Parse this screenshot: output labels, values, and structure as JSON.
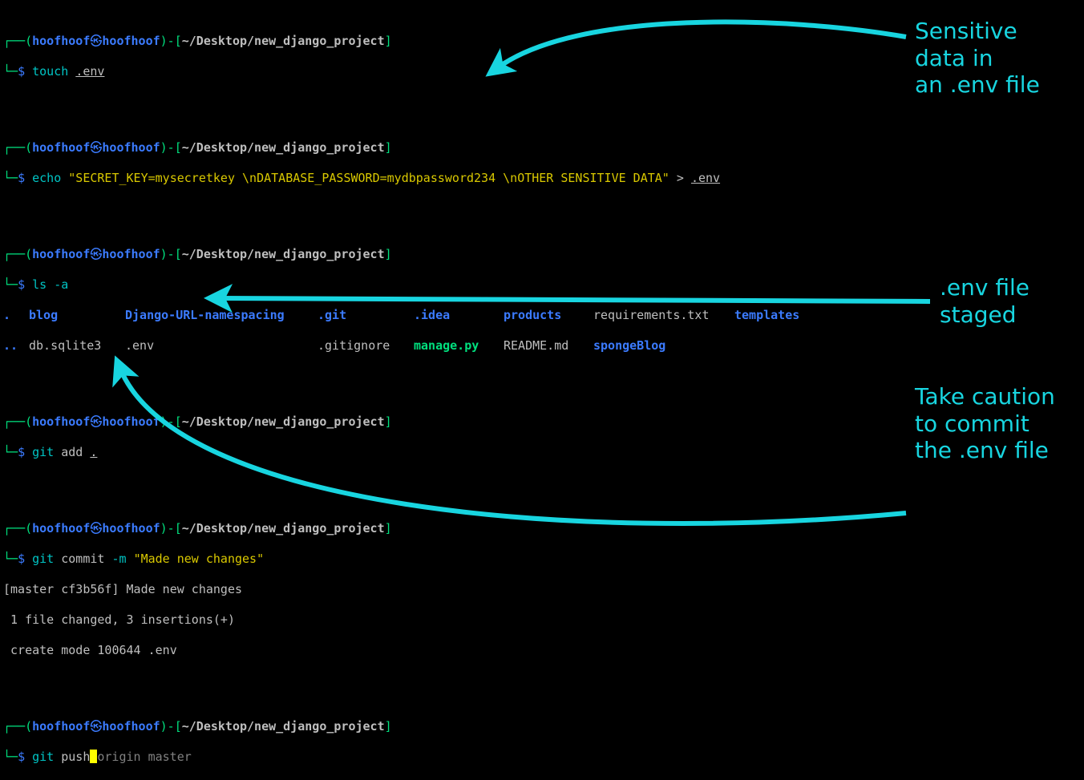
{
  "symbols": {
    "icon": "㉿",
    "top_glyph": "┌──",
    "bottom_glyph": "└─",
    "dash": "─"
  },
  "prompt": {
    "user": "hoofhoof",
    "host": "hoofhoof",
    "path": "~/Desktop/new_django_project",
    "ps1": "$"
  },
  "cmd": {
    "touch": "touch",
    "echo": "echo",
    "ls": "ls",
    "git": "git",
    "add": "add",
    "commit": "commit",
    "push": "push"
  },
  "args": {
    "env": ".env",
    "echo_str": "\"SECRET_KEY=mysecretkey \\nDATABASE_PASSWORD=mydbpassword234 \\nOTHER SENSITIVE DATA\"",
    "redir": ">",
    "ls_a": "-a",
    "add_dot": ".",
    "commit_m": "-m",
    "commit_msg": "\"Made new changes\"",
    "push_done": "push",
    "push_rest": "origin master"
  },
  "ls_output": {
    "row1": {
      "c1": ".",
      "c2": "blog",
      "c3": "Django-URL-namespacing",
      "c4": ".git",
      "c5": ".idea",
      "c6": "products",
      "c7": "requirements.txt",
      "c8": "templates"
    },
    "row2": {
      "c1": "..",
      "c2": "db.sqlite3",
      "c3": ".env",
      "c4": ".gitignore",
      "c5": "manage.py",
      "c6": "README.md",
      "c7": "spongeBlog"
    }
  },
  "commit_output": {
    "l1": "[master cf3b56f] Made new changes",
    "l2": " 1 file changed, 3 insertions(+)",
    "l3": " create mode 100644 .env"
  },
  "annotations": {
    "a1_l1": "Sensitive",
    "a1_l2": "data in",
    "a1_l3": "an .env file",
    "a2_l1": ".env file",
    "a2_l2": "staged",
    "a3_l1": "Take caution",
    "a3_l2": "to commit",
    "a3_l3": "the .env file"
  }
}
